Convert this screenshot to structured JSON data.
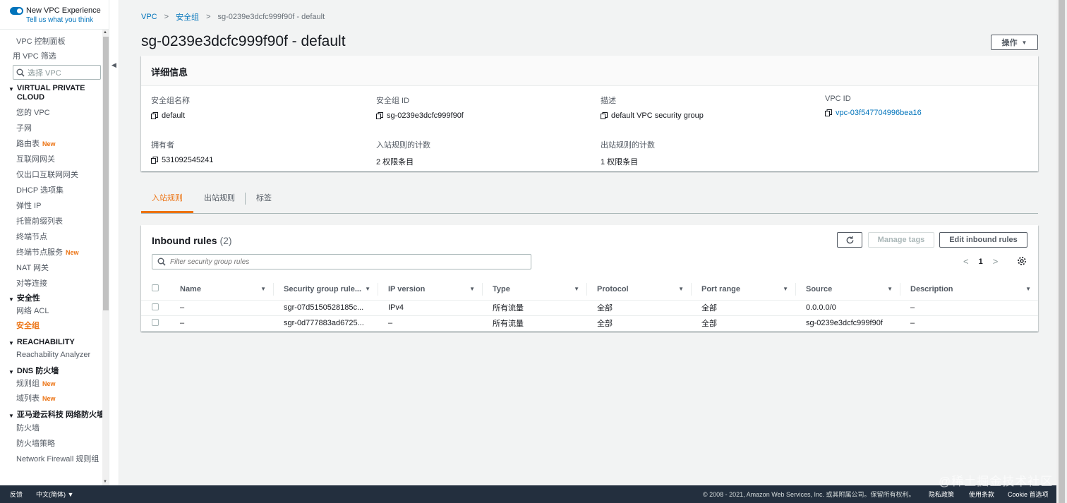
{
  "vpc_experience": {
    "title": "New VPC Experience",
    "link": "Tell us what you think"
  },
  "sidebar": {
    "dashboard": "VPC 控制面板",
    "filter_label": "用 VPC 筛选",
    "select_placeholder": "选择 VPC",
    "section_vpc": "VIRTUAL PRIVATE CLOUD",
    "vpc_items": [
      {
        "label": "您的 VPC",
        "badge": ""
      },
      {
        "label": "子网",
        "badge": ""
      },
      {
        "label": "路由表",
        "badge": "New"
      },
      {
        "label": "互联网网关",
        "badge": ""
      },
      {
        "label": "仅出口互联网网关",
        "badge": ""
      },
      {
        "label": "DHCP 选项集",
        "badge": ""
      },
      {
        "label": "弹性 IP",
        "badge": ""
      },
      {
        "label": "托管前缀列表",
        "badge": ""
      },
      {
        "label": "终端节点",
        "badge": ""
      },
      {
        "label": "终端节点服务",
        "badge": "New"
      },
      {
        "label": "NAT 网关",
        "badge": ""
      },
      {
        "label": "对等连接",
        "badge": ""
      }
    ],
    "section_security": "安全性",
    "security_items": [
      "网络 ACL",
      "安全组"
    ],
    "section_reachability": "REACHABILITY",
    "reachability_items": [
      "Reachability Analyzer"
    ],
    "section_dns": "DNS 防火墙",
    "dns_items": [
      {
        "label": "规则组",
        "badge": "New"
      },
      {
        "label": "域列表",
        "badge": "New"
      }
    ],
    "section_firewall": "亚马逊云科技 网络防火墙",
    "firewall_items": [
      "防火墙",
      "防火墙策略",
      "Network Firewall 规则组"
    ]
  },
  "breadcrumb": {
    "root": "VPC",
    "parent": "安全组",
    "current": "sg-0239e3dcfc999f90f - default"
  },
  "page_title": "sg-0239e3dcfc999f90f - default",
  "actions_label": "操作",
  "details": {
    "heading": "详细信息",
    "sg_name_label": "安全组名称",
    "sg_name": "default",
    "sg_id_label": "安全组 ID",
    "sg_id": "sg-0239e3dcfc999f90f",
    "desc_label": "描述",
    "desc": "default VPC security group",
    "vpc_id_label": "VPC ID",
    "vpc_id": "vpc-03f547704996bea16",
    "owner_label": "拥有者",
    "owner": "531092545241",
    "inbound_count_label": "入站规则的计数",
    "inbound_count": "2 权限条目",
    "outbound_count_label": "出站规则的计数",
    "outbound_count": "1 权限条目"
  },
  "tabs": [
    "入站规则",
    "出站规则",
    "标签"
  ],
  "rules": {
    "title": "Inbound rules",
    "count": "(2)",
    "manage_tags": "Manage tags",
    "edit_rules": "Edit inbound rules",
    "filter_placeholder": "Filter security group rules",
    "page": "1",
    "columns": [
      "Name",
      "Security group rule...",
      "IP version",
      "Type",
      "Protocol",
      "Port range",
      "Source",
      "Description"
    ],
    "rows": [
      [
        "–",
        "sgr-07d5150528185c...",
        "IPv4",
        "所有流量",
        "全部",
        "全部",
        "0.0.0.0/0",
        "–"
      ],
      [
        "–",
        "sgr-0d777883ad6725...",
        "–",
        "所有流量",
        "全部",
        "全部",
        "sg-0239e3dcfc999f90f",
        "–"
      ]
    ]
  },
  "footer": {
    "feedback": "反馈",
    "language": "中文(简体)",
    "copyright": "© 2008 - 2021, Amazon Web Services, Inc. 或其附属公司。保留所有权利。",
    "privacy": "隐私政策",
    "terms": "使用条款",
    "cookie": "Cookie 首选项"
  },
  "watermark": "@稀土掘金技术社区",
  "colors": {
    "link": "#0073bb",
    "accent": "#ec7211",
    "footer_bg": "#232f3e"
  }
}
